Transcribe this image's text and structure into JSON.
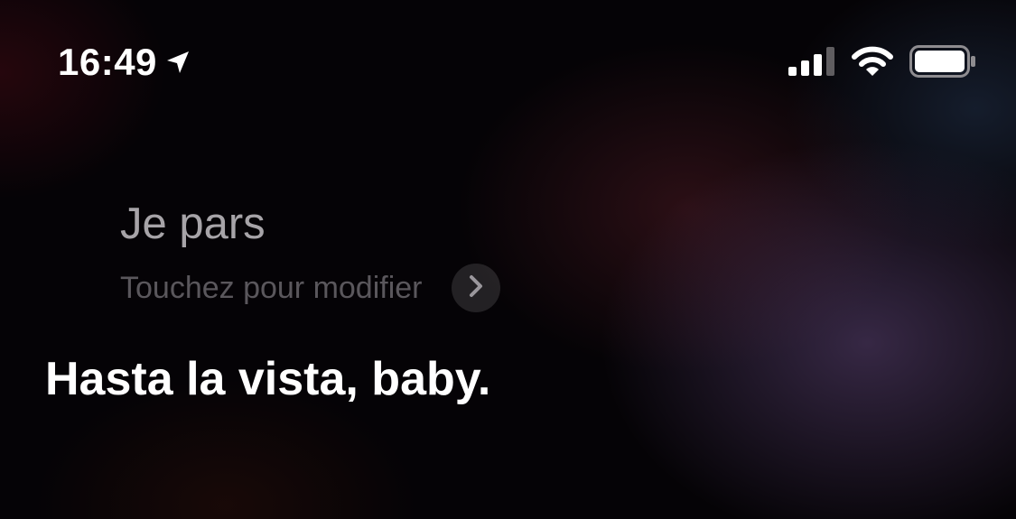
{
  "status_bar": {
    "time": "16:49",
    "location_icon": "location-arrow-icon",
    "signal_icon": "cellular-signal-icon",
    "wifi_icon": "wifi-icon",
    "battery_icon": "battery-icon"
  },
  "siri": {
    "heard_text": "Je pars",
    "edit_hint": "Touchez pour modifier",
    "edit_icon": "chevron-right-icon",
    "reply_text": "Hasta la vista, baby."
  },
  "colors": {
    "background": "#050306",
    "heard_text": "#a7a4a8",
    "hint_text": "#5a575c",
    "reply_text": "#ffffff"
  }
}
